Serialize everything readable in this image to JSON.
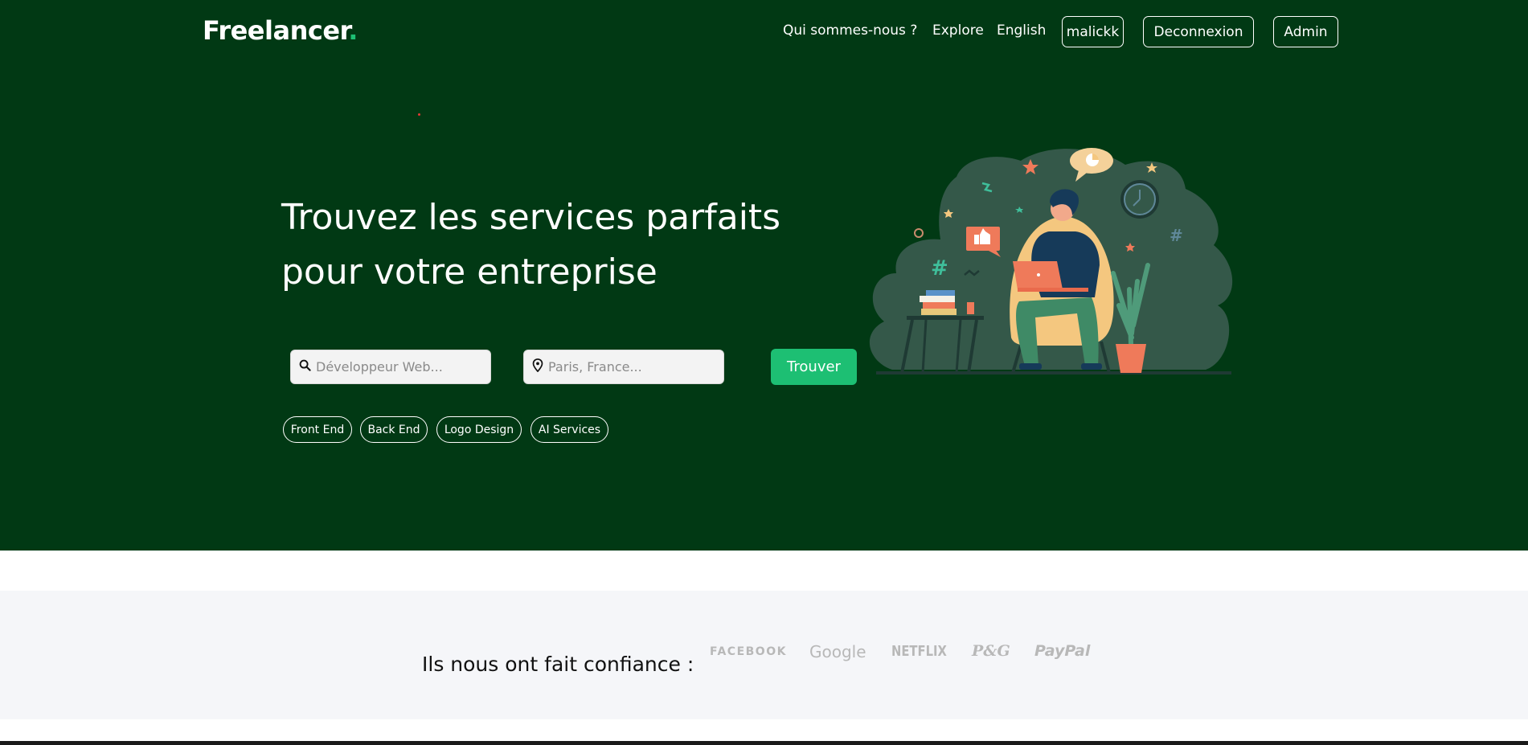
{
  "logo": {
    "text": "Freelancer",
    "dot": "."
  },
  "nav": {
    "about": "Qui sommes-nous ?",
    "explore": "Explore",
    "language": "English",
    "user": "malickk",
    "logout": "Deconnexion",
    "admin": "Admin"
  },
  "hero": {
    "headline_line1": "Trouvez les services parfaits",
    "headline_line2": "pour votre entreprise",
    "search_placeholder": "Développeur Web...",
    "location_placeholder": "Paris, France...",
    "find_button": "Trouver",
    "tags": [
      "Front End",
      "Back End",
      "Logo Design",
      "AI Services"
    ]
  },
  "trust": {
    "label": "Ils nous ont fait confiance :",
    "brands": [
      "FACEBOOK",
      "Google",
      "NETFLIX",
      "P&G",
      "PayPal"
    ]
  },
  "colors": {
    "hero_bg": "#013914",
    "accent": "#1dbf73",
    "trust_bg": "#f5f6f9"
  },
  "icons": {
    "search": "search-icon",
    "location": "location-pin-icon"
  }
}
